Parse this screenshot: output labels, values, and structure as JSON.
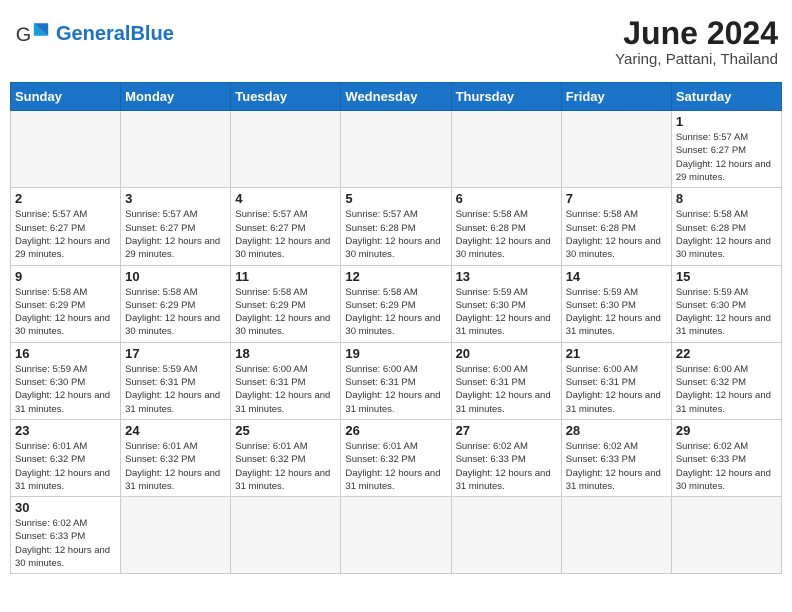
{
  "header": {
    "logo_text_normal": "General",
    "logo_text_blue": "Blue",
    "title": "June 2024",
    "subtitle": "Yaring, Pattani, Thailand"
  },
  "days_of_week": [
    "Sunday",
    "Monday",
    "Tuesday",
    "Wednesday",
    "Thursday",
    "Friday",
    "Saturday"
  ],
  "weeks": [
    [
      {
        "day": "",
        "info": "",
        "empty": true
      },
      {
        "day": "",
        "info": "",
        "empty": true
      },
      {
        "day": "",
        "info": "",
        "empty": true
      },
      {
        "day": "",
        "info": "",
        "empty": true
      },
      {
        "day": "",
        "info": "",
        "empty": true
      },
      {
        "day": "",
        "info": "",
        "empty": true
      },
      {
        "day": "1",
        "info": "Sunrise: 5:57 AM\nSunset: 6:27 PM\nDaylight: 12 hours\nand 29 minutes."
      }
    ],
    [
      {
        "day": "2",
        "info": "Sunrise: 5:57 AM\nSunset: 6:27 PM\nDaylight: 12 hours\nand 29 minutes."
      },
      {
        "day": "3",
        "info": "Sunrise: 5:57 AM\nSunset: 6:27 PM\nDaylight: 12 hours\nand 29 minutes."
      },
      {
        "day": "4",
        "info": "Sunrise: 5:57 AM\nSunset: 6:27 PM\nDaylight: 12 hours\nand 30 minutes."
      },
      {
        "day": "5",
        "info": "Sunrise: 5:57 AM\nSunset: 6:28 PM\nDaylight: 12 hours\nand 30 minutes."
      },
      {
        "day": "6",
        "info": "Sunrise: 5:58 AM\nSunset: 6:28 PM\nDaylight: 12 hours\nand 30 minutes."
      },
      {
        "day": "7",
        "info": "Sunrise: 5:58 AM\nSunset: 6:28 PM\nDaylight: 12 hours\nand 30 minutes."
      },
      {
        "day": "8",
        "info": "Sunrise: 5:58 AM\nSunset: 6:28 PM\nDaylight: 12 hours\nand 30 minutes."
      }
    ],
    [
      {
        "day": "9",
        "info": "Sunrise: 5:58 AM\nSunset: 6:29 PM\nDaylight: 12 hours\nand 30 minutes."
      },
      {
        "day": "10",
        "info": "Sunrise: 5:58 AM\nSunset: 6:29 PM\nDaylight: 12 hours\nand 30 minutes."
      },
      {
        "day": "11",
        "info": "Sunrise: 5:58 AM\nSunset: 6:29 PM\nDaylight: 12 hours\nand 30 minutes."
      },
      {
        "day": "12",
        "info": "Sunrise: 5:58 AM\nSunset: 6:29 PM\nDaylight: 12 hours\nand 30 minutes."
      },
      {
        "day": "13",
        "info": "Sunrise: 5:59 AM\nSunset: 6:30 PM\nDaylight: 12 hours\nand 31 minutes."
      },
      {
        "day": "14",
        "info": "Sunrise: 5:59 AM\nSunset: 6:30 PM\nDaylight: 12 hours\nand 31 minutes."
      },
      {
        "day": "15",
        "info": "Sunrise: 5:59 AM\nSunset: 6:30 PM\nDaylight: 12 hours\nand 31 minutes."
      }
    ],
    [
      {
        "day": "16",
        "info": "Sunrise: 5:59 AM\nSunset: 6:30 PM\nDaylight: 12 hours\nand 31 minutes."
      },
      {
        "day": "17",
        "info": "Sunrise: 5:59 AM\nSunset: 6:31 PM\nDaylight: 12 hours\nand 31 minutes."
      },
      {
        "day": "18",
        "info": "Sunrise: 6:00 AM\nSunset: 6:31 PM\nDaylight: 12 hours\nand 31 minutes."
      },
      {
        "day": "19",
        "info": "Sunrise: 6:00 AM\nSunset: 6:31 PM\nDaylight: 12 hours\nand 31 minutes."
      },
      {
        "day": "20",
        "info": "Sunrise: 6:00 AM\nSunset: 6:31 PM\nDaylight: 12 hours\nand 31 minutes."
      },
      {
        "day": "21",
        "info": "Sunrise: 6:00 AM\nSunset: 6:31 PM\nDaylight: 12 hours\nand 31 minutes."
      },
      {
        "day": "22",
        "info": "Sunrise: 6:00 AM\nSunset: 6:32 PM\nDaylight: 12 hours\nand 31 minutes."
      }
    ],
    [
      {
        "day": "23",
        "info": "Sunrise: 6:01 AM\nSunset: 6:32 PM\nDaylight: 12 hours\nand 31 minutes."
      },
      {
        "day": "24",
        "info": "Sunrise: 6:01 AM\nSunset: 6:32 PM\nDaylight: 12 hours\nand 31 minutes."
      },
      {
        "day": "25",
        "info": "Sunrise: 6:01 AM\nSunset: 6:32 PM\nDaylight: 12 hours\nand 31 minutes."
      },
      {
        "day": "26",
        "info": "Sunrise: 6:01 AM\nSunset: 6:32 PM\nDaylight: 12 hours\nand 31 minutes."
      },
      {
        "day": "27",
        "info": "Sunrise: 6:02 AM\nSunset: 6:33 PM\nDaylight: 12 hours\nand 31 minutes."
      },
      {
        "day": "28",
        "info": "Sunrise: 6:02 AM\nSunset: 6:33 PM\nDaylight: 12 hours\nand 31 minutes."
      },
      {
        "day": "29",
        "info": "Sunrise: 6:02 AM\nSunset: 6:33 PM\nDaylight: 12 hours\nand 30 minutes."
      }
    ],
    [
      {
        "day": "30",
        "info": "Sunrise: 6:02 AM\nSunset: 6:33 PM\nDaylight: 12 hours\nand 30 minutes."
      },
      {
        "day": "",
        "info": "",
        "empty": true
      },
      {
        "day": "",
        "info": "",
        "empty": true
      },
      {
        "day": "",
        "info": "",
        "empty": true
      },
      {
        "day": "",
        "info": "",
        "empty": true
      },
      {
        "day": "",
        "info": "",
        "empty": true
      },
      {
        "day": "",
        "info": "",
        "empty": true
      }
    ]
  ]
}
